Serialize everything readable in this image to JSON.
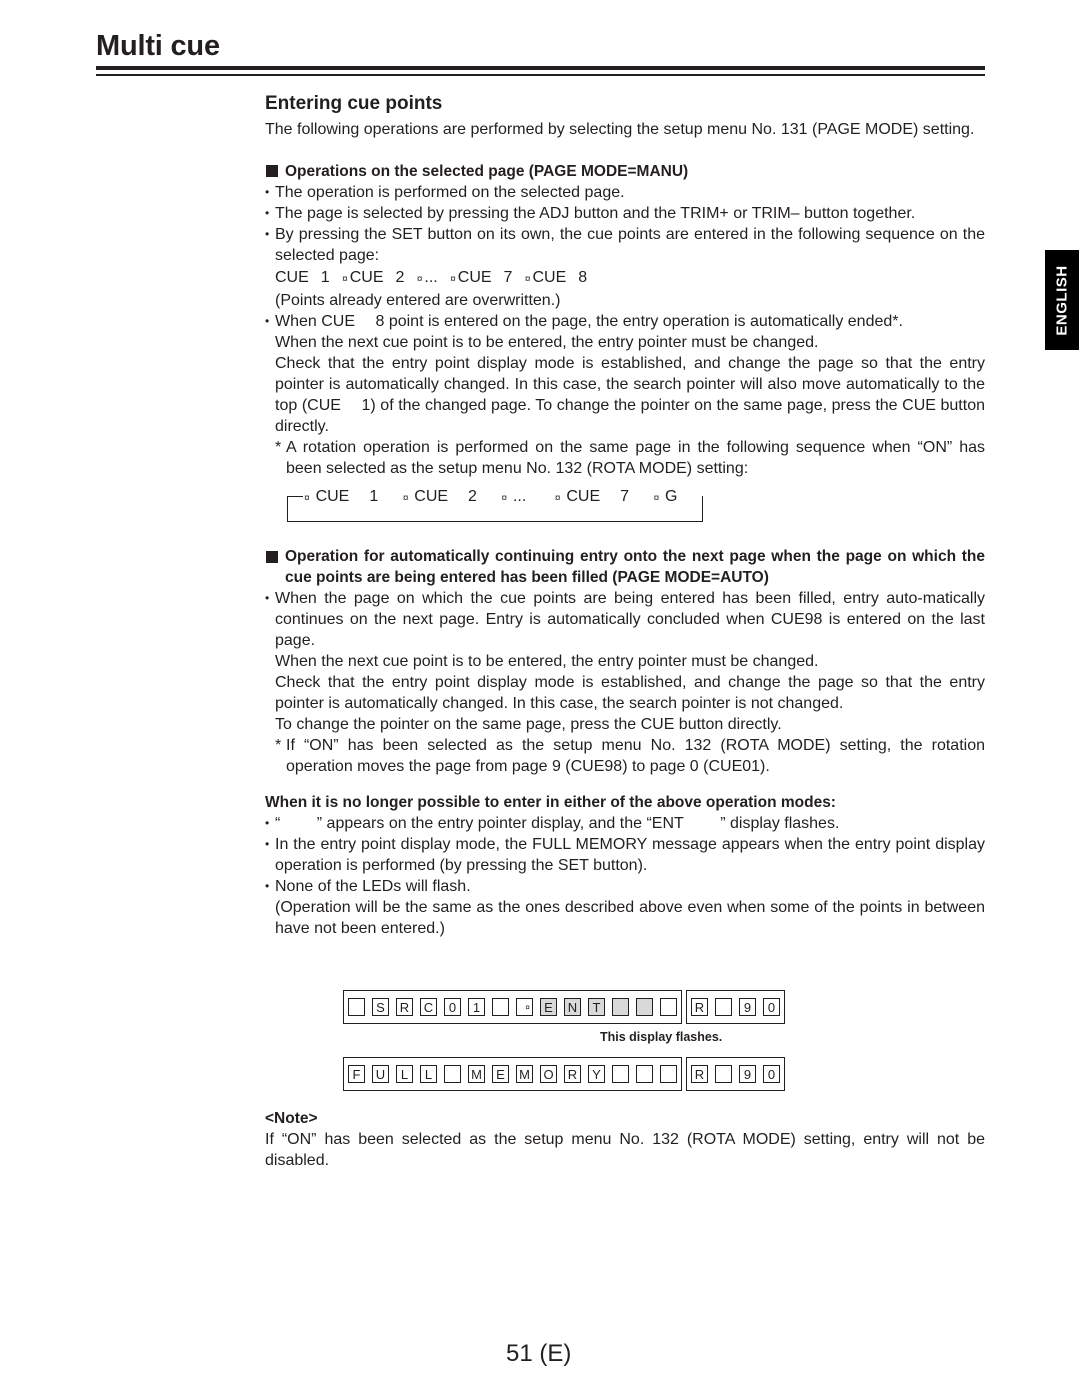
{
  "header": {
    "title": "Multi cue",
    "language_tab": "ENGLISH"
  },
  "section": {
    "heading": "Entering cue points",
    "intro": "The following operations are performed by selecting the setup menu No. 131 (PAGE MODE) setting."
  },
  "manu": {
    "heading": "Operations on the selected page (PAGE MODE=MANU)",
    "bullet1": "The operation is performed on the selected page.",
    "bullet2": "The page is selected by pressing the ADJ button and the TRIM+ or TRIM– button together.",
    "bullet3": "By pressing the SET button on its own, the cue points are entered in the following sequence on the selected page:",
    "sequence": [
      {
        "label": "CUE",
        "num": "1"
      },
      {
        "label": "CUE",
        "num": "2"
      },
      {
        "label": "...",
        "num": ""
      },
      {
        "label": "CUE",
        "num": "7"
      },
      {
        "label": "CUE",
        "num": "8"
      }
    ],
    "arrow_glyph": "¤",
    "overwrite_note": "(Points already entered are overwritten.)",
    "bullet4_line1": "When CUE  8 point is entered on the page, the entry operation is automatically ended*.",
    "bullet4_line2": "When the next cue point is to be entered, the entry pointer must be changed.",
    "bullet4_para": "Check that the entry point display mode is established, and change the page so that the entry pointer is automatically changed. In this case, the search pointer will also move automatically to the top (CUE  1) of the changed page. To change the pointer on the same page, press the CUE button directly.",
    "footnote_mark": "*",
    "footnote": "A rotation operation is performed on the same page in the following sequence when “ON” has been selected as the setup menu No. 132 (ROTA MODE) setting:",
    "rotation_sequence": [
      {
        "label": "CUE",
        "num": "1"
      },
      {
        "label": "CUE",
        "num": "2"
      },
      {
        "label": "...",
        "num": ""
      },
      {
        "label": "CUE",
        "num": "7"
      },
      {
        "label": "G",
        "num": ""
      }
    ]
  },
  "auto": {
    "heading": "Operation for automatically continuing entry onto the next page when the page on which the cue points are being entered has been filled (PAGE MODE=AUTO)",
    "bullet1": "When the page on which the cue points are being entered has been filled, entry auto-matically continues on the next page. Entry is automatically concluded when CUE98 is entered on the last page.",
    "para1": "When the next cue point is to be entered, the entry pointer must be changed.",
    "para2": "Check that the entry point display mode is established, and change the page so that the entry pointer is automatically changed. In this case, the search pointer is not changed.",
    "para3": "To change the pointer on the same page, press the CUE button directly.",
    "footnote_mark": "*",
    "footnote": "If “ON” has been selected as the setup menu No. 132 (ROTA MODE) setting, the rotation operation moves the page from page 9 (CUE98) to page 0 (CUE01)."
  },
  "full": {
    "heading": "When it is no longer possible to enter in either of the above operation modes:",
    "bullet1": "“   ” appears on the entry pointer display, and the “ENT   ” display flashes.",
    "bullet2": "In the entry point display mode, the FULL MEMORY message appears when the entry point display operation is performed (by pressing the SET button).",
    "bullet3": "None of the LEDs will flash.",
    "para": "(Operation will be the same as the ones described above even when some of the points in between have not been entered.)"
  },
  "display1": {
    "main_cells": [
      "",
      "S",
      "R",
      "C",
      "0",
      "1",
      "",
      "",
      "E",
      "N",
      "T",
      "",
      "",
      ""
    ],
    "highlighted_cells": [
      8,
      9,
      10,
      11,
      12
    ],
    "pointer_cell": 7,
    "side_cells": [
      "R",
      "",
      "9",
      "0"
    ],
    "caption": "This display flashes."
  },
  "display2": {
    "main_cells": [
      "F",
      "U",
      "L",
      "L",
      "",
      "M",
      "E",
      "M",
      "O",
      "R",
      "Y",
      "",
      "",
      ""
    ],
    "side_cells": [
      "R",
      "",
      "9",
      "0"
    ]
  },
  "note": {
    "heading": "<Note>",
    "text": "If “ON” has been selected as the setup menu No. 132 (ROTA MODE) setting, entry will not be disabled."
  },
  "footer": {
    "page_number": "51 (E)"
  }
}
